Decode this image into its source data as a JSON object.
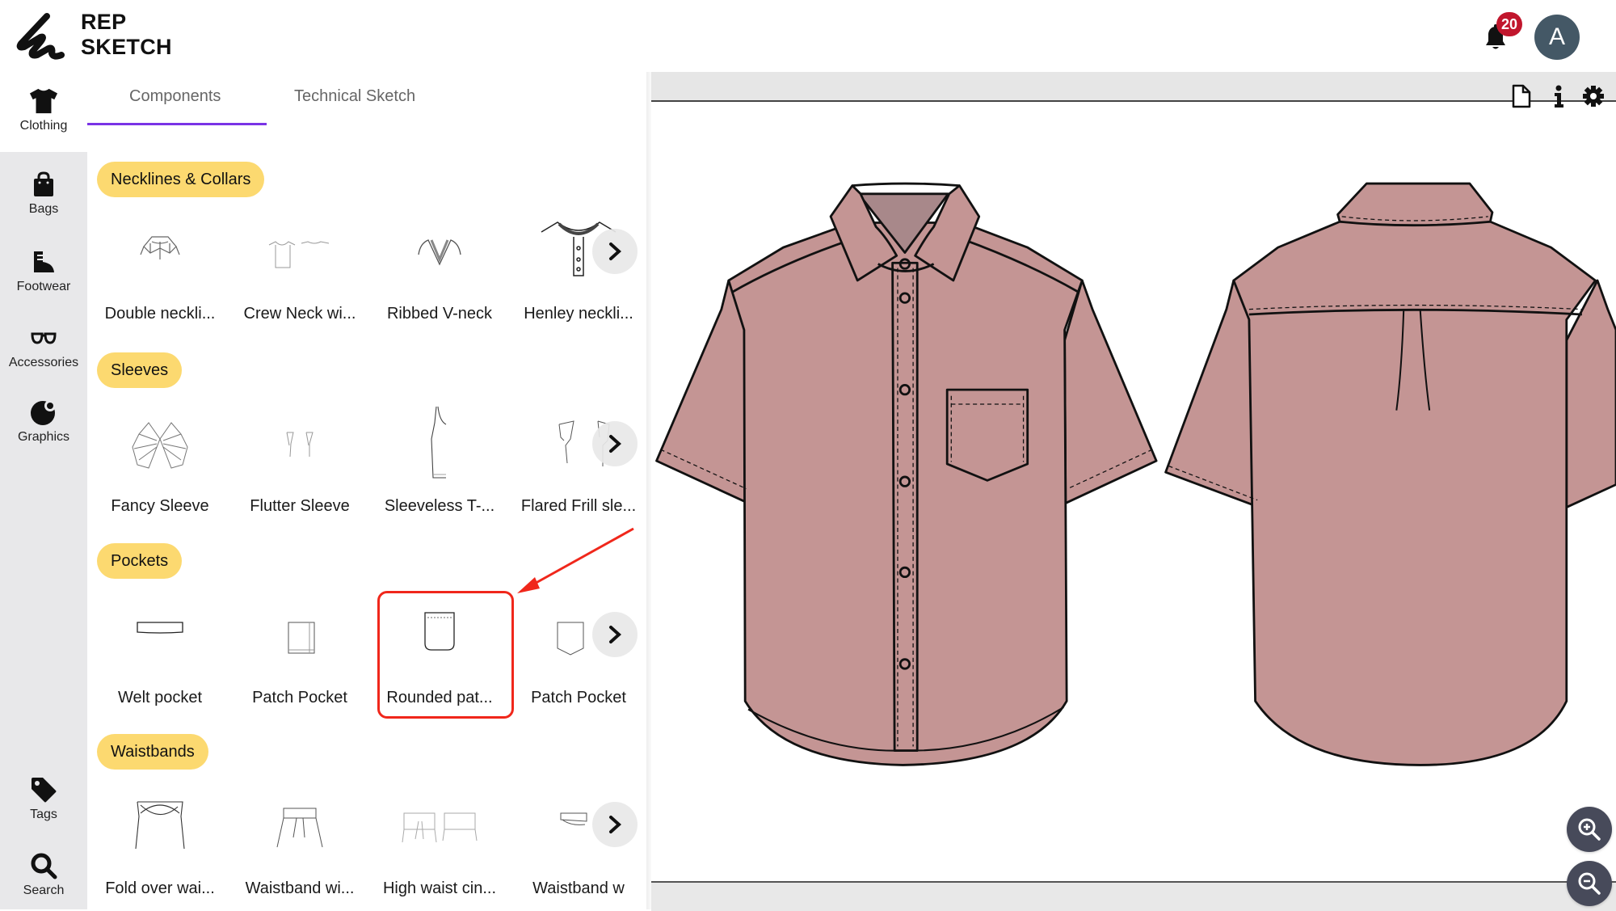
{
  "app": {
    "name_line1": "REP",
    "name_line2": "SKETCH"
  },
  "header": {
    "notification_count": "20",
    "avatar_initial": "A"
  },
  "sidebar": {
    "items": [
      {
        "label": "Clothing",
        "icon": "tshirt-icon",
        "active": true
      },
      {
        "label": "Bags",
        "icon": "bag-icon"
      },
      {
        "label": "Footwear",
        "icon": "boot-icon"
      },
      {
        "label": "Accessories",
        "icon": "glasses-icon"
      },
      {
        "label": "Graphics",
        "icon": "graphics-icon"
      },
      {
        "label": "Tags",
        "icon": "tag-icon"
      },
      {
        "label": "Search",
        "icon": "search-icon"
      }
    ]
  },
  "tabs": [
    {
      "label": "Components",
      "active": true
    },
    {
      "label": "Technical Sketch",
      "active": false
    }
  ],
  "categories": [
    {
      "title": "Necklines & Collars",
      "items": [
        "Double neckli...",
        "Crew Neck wi...",
        "Ribbed V-neck",
        "Henley neckli..."
      ]
    },
    {
      "title": "Sleeves",
      "items": [
        "Fancy Sleeve",
        "Flutter Sleeve",
        "Sleeveless T-...",
        "Flared Frill sle..."
      ]
    },
    {
      "title": "Pockets",
      "items": [
        "Welt pocket",
        "Patch Pocket",
        "Rounded pat...",
        "Patch Pocket"
      ]
    },
    {
      "title": "Waistbands",
      "items": [
        "Fold over wai...",
        "Waistband wi...",
        "High waist cin...",
        "Waistband w"
      ]
    }
  ],
  "highlighted_item": "Rounded pat...",
  "canvas": {
    "tools": [
      "document-icon",
      "info-icon",
      "settings-icon"
    ],
    "garment_color": "#c49594",
    "views": [
      "front",
      "back"
    ]
  },
  "colors": {
    "accent": "#7a33e6",
    "pill": "#fcd970",
    "badge": "#c1162d",
    "annotation": "#f0271b"
  }
}
